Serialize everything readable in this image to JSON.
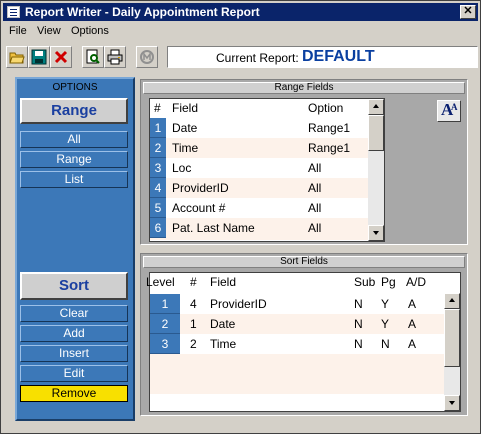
{
  "window": {
    "title": "Report Writer - Daily Appointment Report",
    "close_label": "✕"
  },
  "menu": {
    "items": [
      "File",
      "View",
      "Options"
    ]
  },
  "toolbar": {
    "buttons": [
      "open-icon",
      "save-icon",
      "delete-icon",
      "preview-icon",
      "print-icon",
      "disabled-icon"
    ],
    "current_report_label": "Current Report:",
    "current_report_value": "DEFAULT"
  },
  "options": {
    "heading": "OPTIONS",
    "range_title": "Range",
    "range_buttons": [
      "All",
      "Range",
      "List"
    ],
    "sort_title": "Sort",
    "sort_buttons": [
      "Clear",
      "Add",
      "Insert",
      "Edit",
      "Remove"
    ]
  },
  "range_fields": {
    "title": "Range Fields",
    "columns": [
      "#",
      "Field",
      "Option"
    ],
    "rows": [
      {
        "num": "1",
        "field": "Date",
        "option": "Range1"
      },
      {
        "num": "2",
        "field": "Time",
        "option": "Range1"
      },
      {
        "num": "3",
        "field": "Loc",
        "option": "All"
      },
      {
        "num": "4",
        "field": "ProviderID",
        "option": "All"
      },
      {
        "num": "5",
        "field": "Account #",
        "option": "All"
      },
      {
        "num": "6",
        "field": "Pat. Last Name",
        "option": "All"
      }
    ]
  },
  "sort_fields": {
    "title": "Sort Fields",
    "columns": [
      "Level",
      "#",
      "Field",
      "Sub",
      "Pg",
      "A/D"
    ],
    "rows": [
      {
        "level": "1",
        "num": "4",
        "field": "ProviderID",
        "sub": "N",
        "pg": "Y",
        "ad": "A"
      },
      {
        "level": "2",
        "num": "1",
        "field": "Date",
        "sub": "N",
        "pg": "Y",
        "ad": "A"
      },
      {
        "level": "3",
        "num": "2",
        "field": "Time",
        "sub": "N",
        "pg": "N",
        "ad": "A"
      }
    ]
  },
  "colors": {
    "accent_blue": "#3c78b8",
    "title_bar": "#0a246a",
    "highlight_yellow": "#f8e000"
  }
}
